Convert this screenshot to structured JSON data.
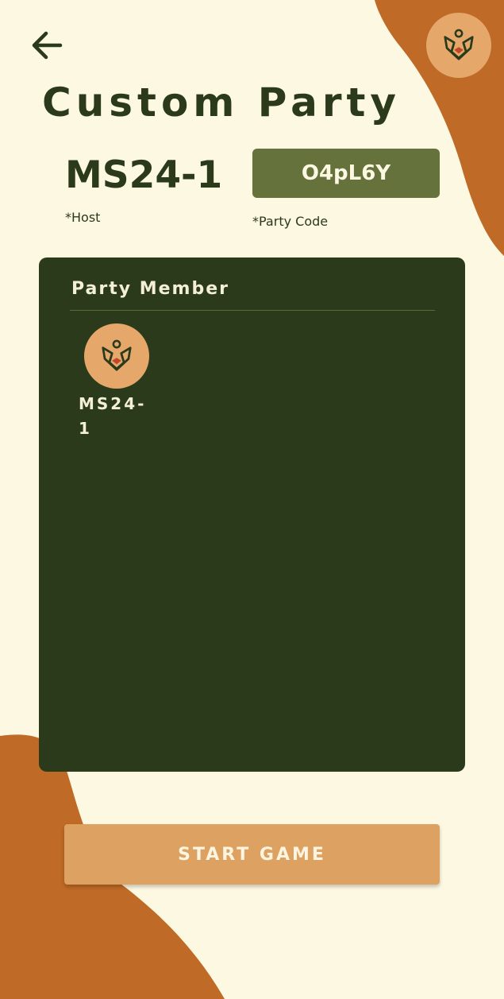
{
  "header": {
    "back_icon": "arrow-left-icon",
    "profile_icon": "fox-mask-icon",
    "title": "Custom Party"
  },
  "host": {
    "name": "MS24-1",
    "label": "*Host"
  },
  "party": {
    "code": "O4pL6Y",
    "code_label": "*Party Code"
  },
  "members_panel": {
    "title": "Party Member",
    "members": [
      {
        "name": "MS24-1",
        "avatar_icon": "fox-mask-icon"
      }
    ]
  },
  "actions": {
    "start_label": "START GAME"
  },
  "colors": {
    "background": "#fdf8e2",
    "accent_orange": "#bf6a26",
    "panel_green": "#2b3a1b",
    "code_green": "#65723c",
    "avatar_tan": "#e5a86a",
    "button_tan": "#dda262"
  }
}
